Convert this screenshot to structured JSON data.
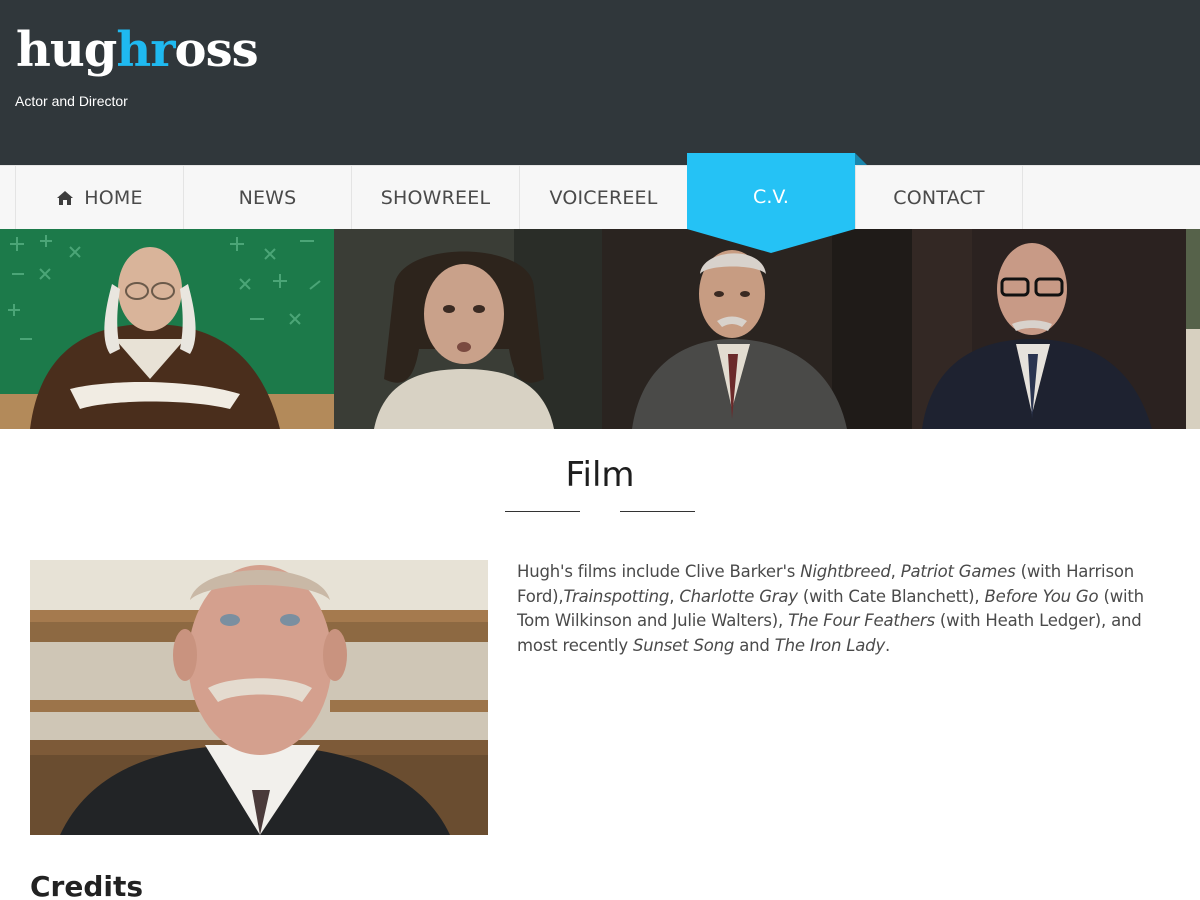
{
  "site": {
    "logo_part1": "hug",
    "logo_part2": "hr",
    "logo_part3": "oss",
    "tagline": "Actor and Director"
  },
  "colors": {
    "header_bg": "#30373b",
    "accent": "#25c2f5",
    "logo_highlight": "#1fb9f0"
  },
  "nav": {
    "items": [
      {
        "label": "HOME",
        "icon": "home-icon"
      },
      {
        "label": "NEWS"
      },
      {
        "label": "SHOWREEL"
      },
      {
        "label": "VOICEREEL"
      },
      {
        "label": "C.V.",
        "active": true
      },
      {
        "label": "CONTACT"
      }
    ]
  },
  "section": {
    "title": "Film",
    "paragraph": {
      "p1": "Hugh's films include Clive Barker's ",
      "i1": "Nightbreed",
      "p2": ", ",
      "i2": "Patriot Games",
      "p3": " (with Harrison Ford),",
      "i3": "Trainspotting",
      "p4": ", ",
      "i4": "Charlotte Gray",
      "p5": " (with Cate Blanchett), ",
      "i5": "Before You Go",
      "p6": " (with Tom Wilkinson and Julie Walters), ",
      "i6": "The Four Feathers",
      "p7": " (with Heath Ledger), and most recently ",
      "i7": "Sunset Song",
      "p8": " and ",
      "i8": "The Iron Lady",
      "p9": "."
    },
    "credits_heading": "Credits"
  }
}
